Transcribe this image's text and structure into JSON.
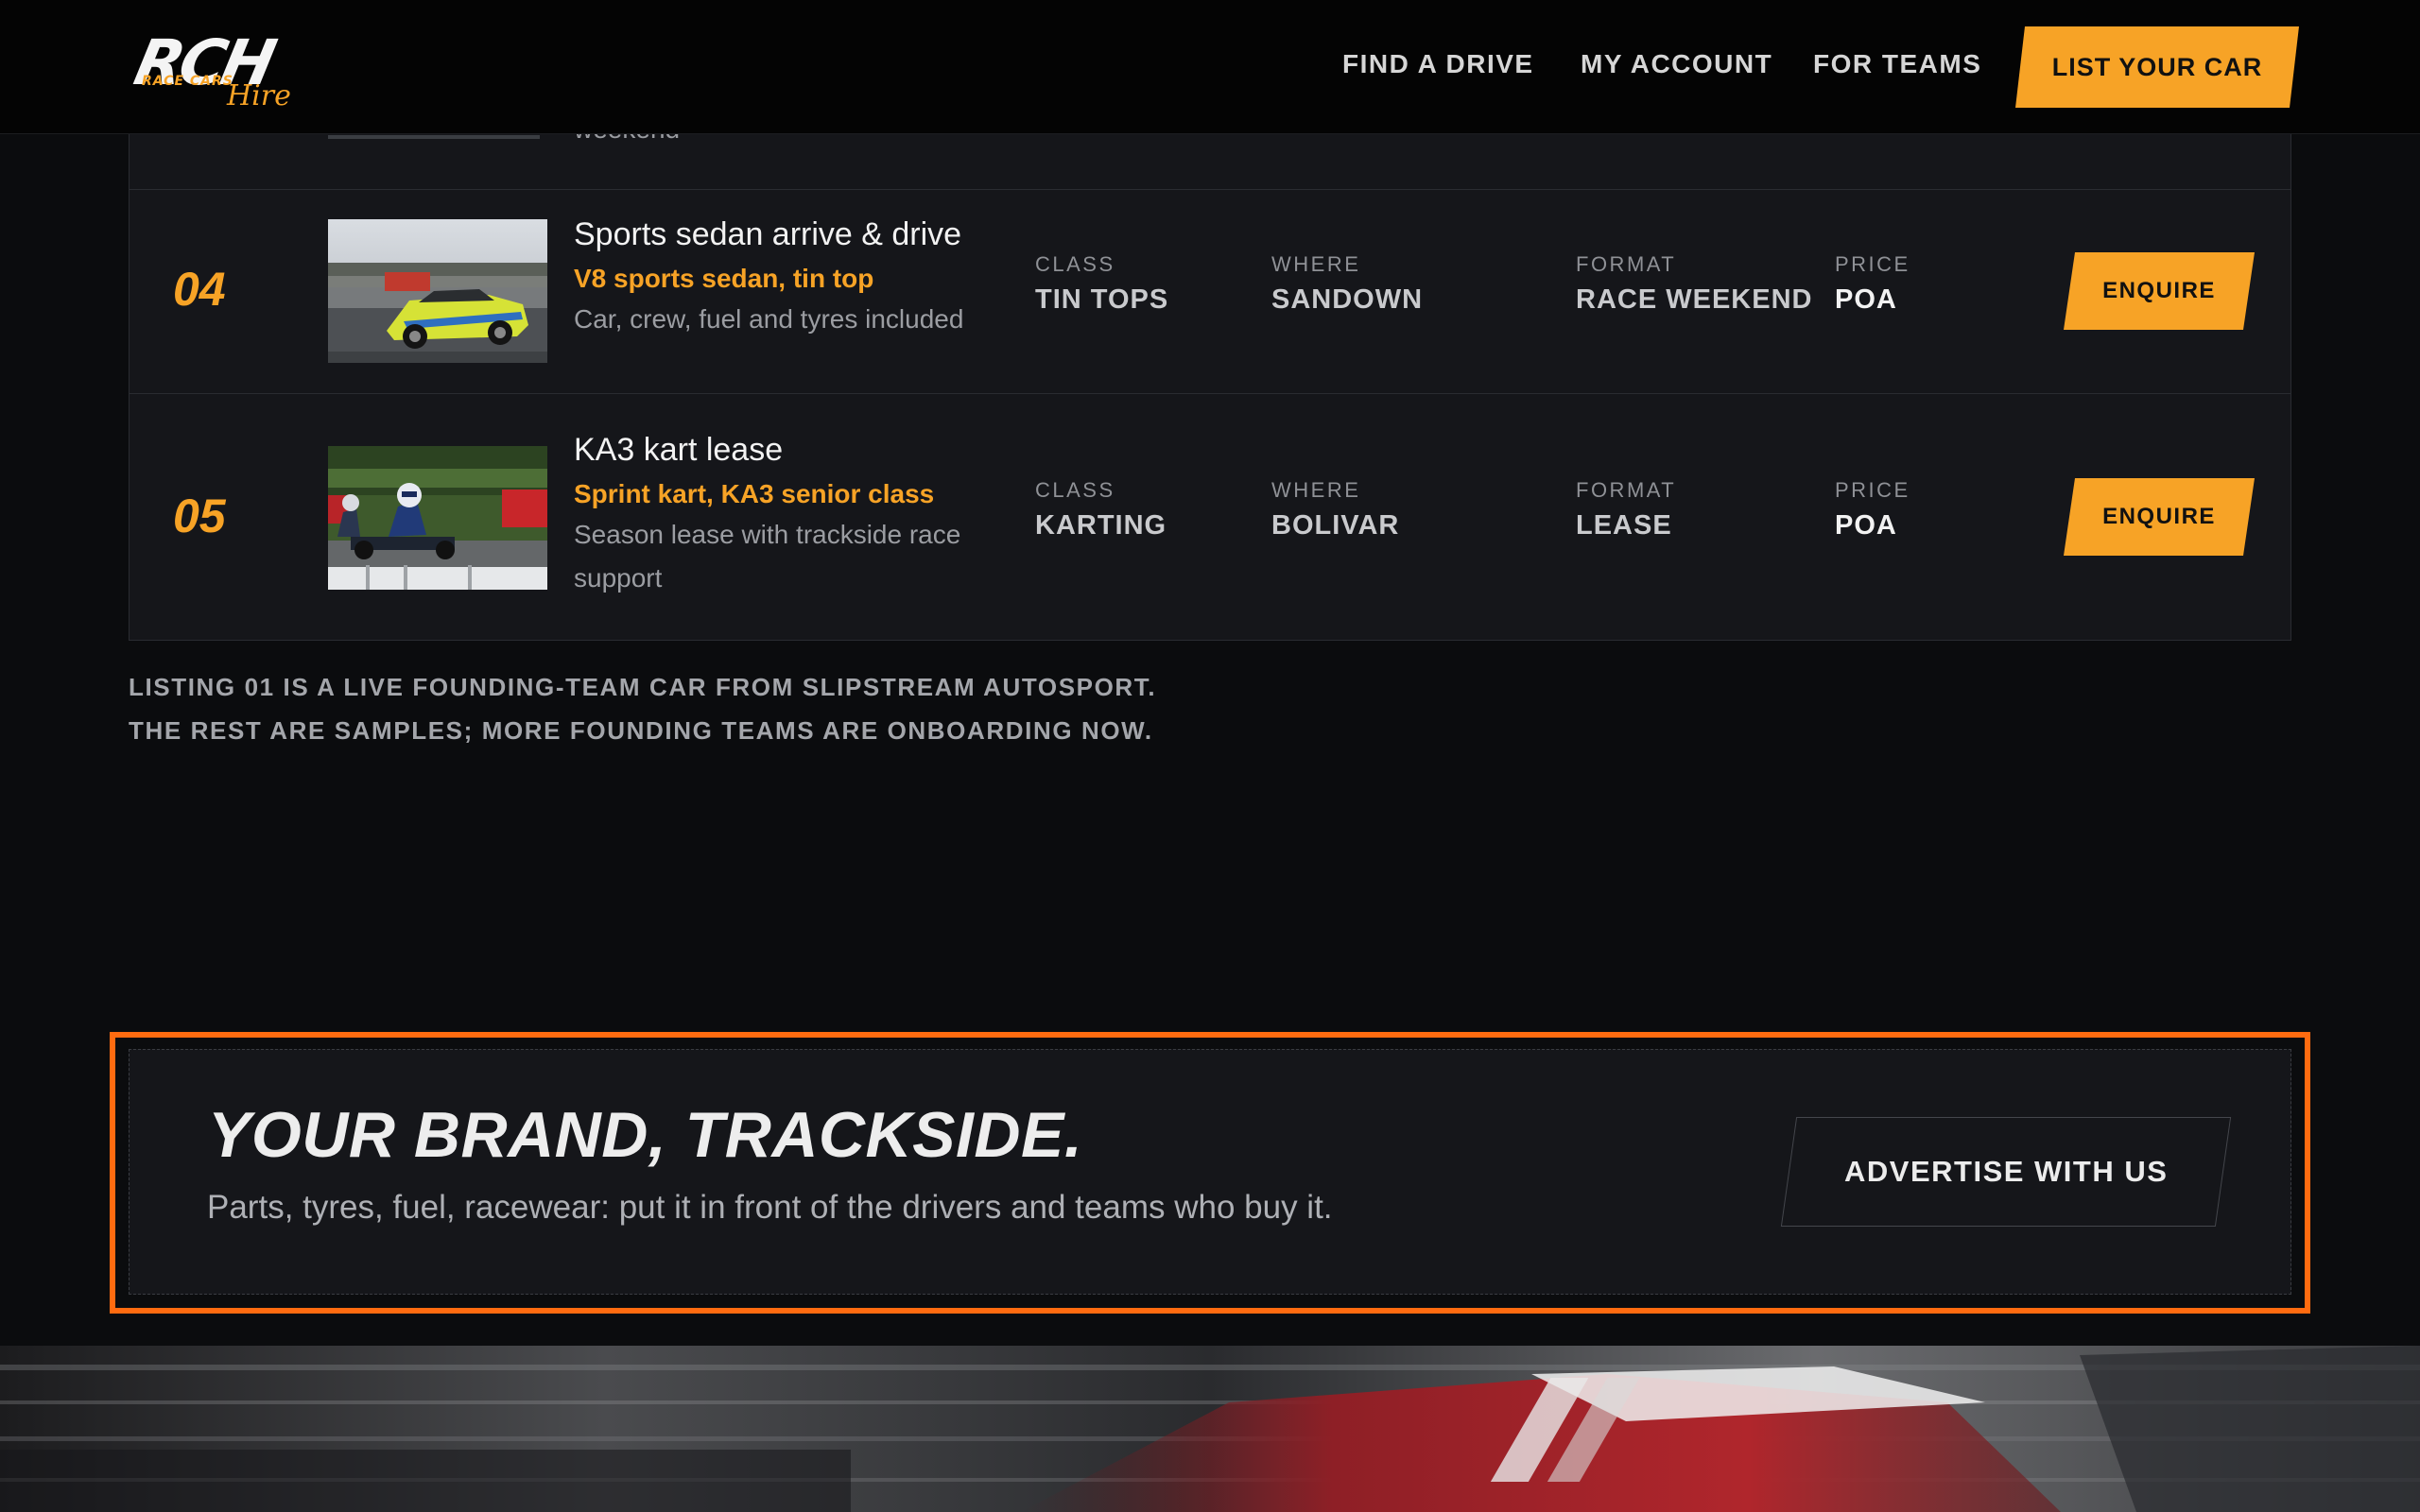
{
  "header": {
    "logo": {
      "mark": "RCH",
      "sub": "RACE CARS",
      "script": "Hire"
    },
    "nav": [
      "FIND A DRIVE",
      "MY ACCOUNT",
      "FOR TEAMS"
    ],
    "cta": "LIST YOUR CAR"
  },
  "listings": {
    "previous_row_overflow": "weekend",
    "rows": [
      {
        "num": "04",
        "title": "Sports sedan arrive & drive",
        "subtitle": "V8 sports sedan, tin top",
        "desc": "Car, crew, fuel and tyres included",
        "labels": {
          "class": "CLASS",
          "where": "WHERE",
          "format": "FORMAT",
          "price": "PRICE"
        },
        "class": "TIN TOPS",
        "where": "SANDOWN",
        "format": "RACE WEEKEND",
        "price": "POA",
        "button": "ENQUIRE"
      },
      {
        "num": "05",
        "title": "KA3 kart lease",
        "subtitle": "Sprint kart, KA3 senior class",
        "desc": "Season lease with trackside race support",
        "labels": {
          "class": "CLASS",
          "where": "WHERE",
          "format": "FORMAT",
          "price": "PRICE"
        },
        "class": "KARTING",
        "where": "BOLIVAR",
        "format": "LEASE",
        "price": "POA",
        "button": "ENQUIRE"
      }
    ]
  },
  "footnote": [
    "LISTING 01 IS A LIVE FOUNDING-TEAM CAR FROM SLIPSTREAM AUTOSPORT.",
    "THE REST ARE SAMPLES; MORE FOUNDING TEAMS ARE ONBOARDING NOW."
  ],
  "ad": {
    "title": "YOUR BRAND, TRACKSIDE.",
    "subtitle": "Parts, tyres, fuel, racewear: put it in front of the drivers and teams who buy it.",
    "button": "ADVERTISE WITH US"
  },
  "colors": {
    "accent": "#f7a326",
    "highlight_outline": "#ff6b10",
    "background": "#0b0c0e",
    "panel": "#15161a"
  }
}
